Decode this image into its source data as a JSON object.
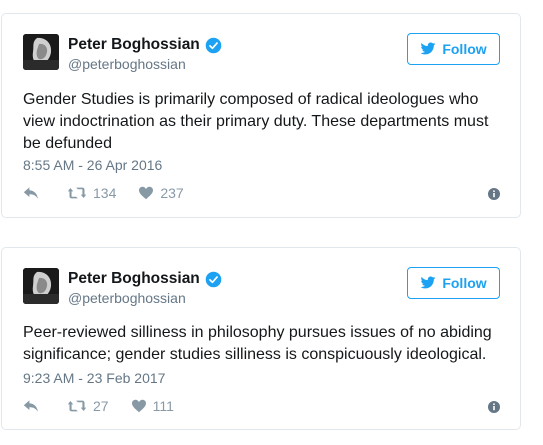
{
  "colors": {
    "accent": "#1da1f2",
    "muted": "#657786",
    "icon": "#8899a6",
    "border": "#e1e8ed"
  },
  "tweets": [
    {
      "name": "Peter Boghossian",
      "handle": "@peterboghossian",
      "follow_label": "Follow",
      "text": "Gender Studies is primarily composed of radical ideologues who view indoctrination as their primary duty. These departments must be defunded",
      "timestamp": "8:55 AM - 26 Apr 2016",
      "retweets": "134",
      "likes": "237",
      "icons": [
        "verified-badge-icon",
        "twitter-bird-icon",
        "reply-icon",
        "retweet-icon",
        "heart-icon",
        "info-icon"
      ]
    },
    {
      "name": "Peter Boghossian",
      "handle": "@peterboghossian",
      "follow_label": "Follow",
      "text": "Peer-reviewed silliness in philosophy pursues issues of no abiding significance; gender studies silliness is conspicuously ideological.",
      "timestamp": "9:23 AM - 23 Feb 2017",
      "retweets": "27",
      "likes": "111",
      "icons": [
        "verified-badge-icon",
        "twitter-bird-icon",
        "reply-icon",
        "retweet-icon",
        "heart-icon",
        "info-icon"
      ]
    }
  ]
}
